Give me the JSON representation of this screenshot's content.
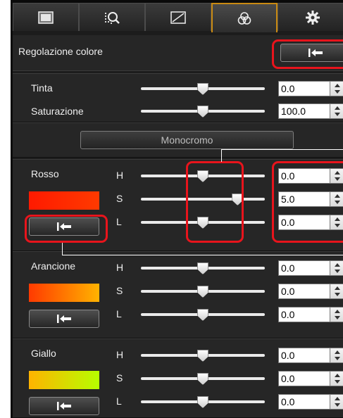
{
  "tabs": [
    {
      "icon": "basic-adjustment-icon",
      "active": false
    },
    {
      "icon": "detail-zoom-icon",
      "active": false
    },
    {
      "icon": "tone-curve-icon",
      "active": false
    },
    {
      "icon": "color-adjustment-icon",
      "active": true
    },
    {
      "icon": "settings-gear-icon",
      "active": false
    }
  ],
  "header": {
    "title": "Regolazione colore",
    "reset_icon": "reset-arrow-icon"
  },
  "global": {
    "rows": [
      {
        "label": "Tinta",
        "value": "0.0",
        "level": 0.5
      },
      {
        "label": "Saturazione",
        "value": "100.0",
        "level": 0.5
      }
    ]
  },
  "monochrome_button": "Monocromo",
  "groups": [
    {
      "name": "Rosso",
      "swatch": [
        "#ff1a00",
        "#ff3a00"
      ],
      "rows": [
        {
          "channel": "H",
          "value": "0.0",
          "level": 0.5
        },
        {
          "channel": "S",
          "value": "5.0",
          "level": 0.78
        },
        {
          "channel": "L",
          "value": "0.0",
          "level": 0.5
        }
      ]
    },
    {
      "name": "Arancione",
      "swatch": [
        "#ff3a00",
        "#ffb300"
      ],
      "rows": [
        {
          "channel": "H",
          "value": "0.0",
          "level": 0.5
        },
        {
          "channel": "S",
          "value": "0.0",
          "level": 0.5
        },
        {
          "channel": "L",
          "value": "0.0",
          "level": 0.5
        }
      ]
    },
    {
      "name": "Giallo",
      "swatch": [
        "#ffb300",
        "#b6ff00"
      ],
      "rows": [
        {
          "channel": "H",
          "value": "0.0",
          "level": 0.5
        },
        {
          "channel": "S",
          "value": "0.0",
          "level": 0.5
        },
        {
          "channel": "L",
          "value": "0.0",
          "level": 0.5
        }
      ]
    }
  ],
  "colors": {
    "highlight": "#e8141c",
    "active_tab_border": "#c98a12",
    "panel_bg": "#262626"
  }
}
